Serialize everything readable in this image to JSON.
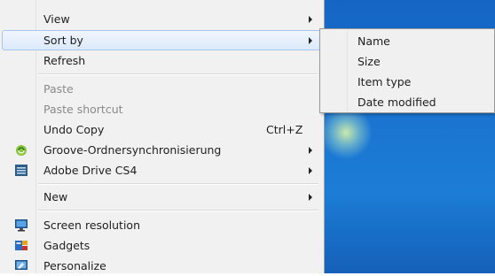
{
  "menu": {
    "items": [
      {
        "label": "View",
        "has_submenu": true
      },
      {
        "label": "Sort by",
        "has_submenu": true,
        "highlighted": true
      },
      {
        "label": "Refresh"
      },
      {
        "label": "Paste",
        "disabled": true
      },
      {
        "label": "Paste shortcut",
        "disabled": true
      },
      {
        "label": "Undo Copy",
        "shortcut": "Ctrl+Z"
      },
      {
        "label": "Groove-Ordnersynchronisierung",
        "has_submenu": true,
        "icon": "groove-sync-icon"
      },
      {
        "label": "Adobe Drive CS4",
        "has_submenu": true,
        "icon": "adobe-drive-icon"
      },
      {
        "label": "New",
        "has_submenu": true
      },
      {
        "label": "Screen resolution",
        "icon": "monitor-icon"
      },
      {
        "label": "Gadgets",
        "icon": "gadgets-icon"
      },
      {
        "label": "Personalize",
        "icon": "personalize-icon"
      }
    ]
  },
  "submenu": {
    "parent": "Sort by",
    "items": [
      {
        "label": "Name"
      },
      {
        "label": "Size"
      },
      {
        "label": "Item type"
      },
      {
        "label": "Date modified"
      }
    ]
  },
  "colors": {
    "desktop": "#1a73cf",
    "highlight_border": "#a8c6ea",
    "menu_background": "#f1f1f1"
  }
}
